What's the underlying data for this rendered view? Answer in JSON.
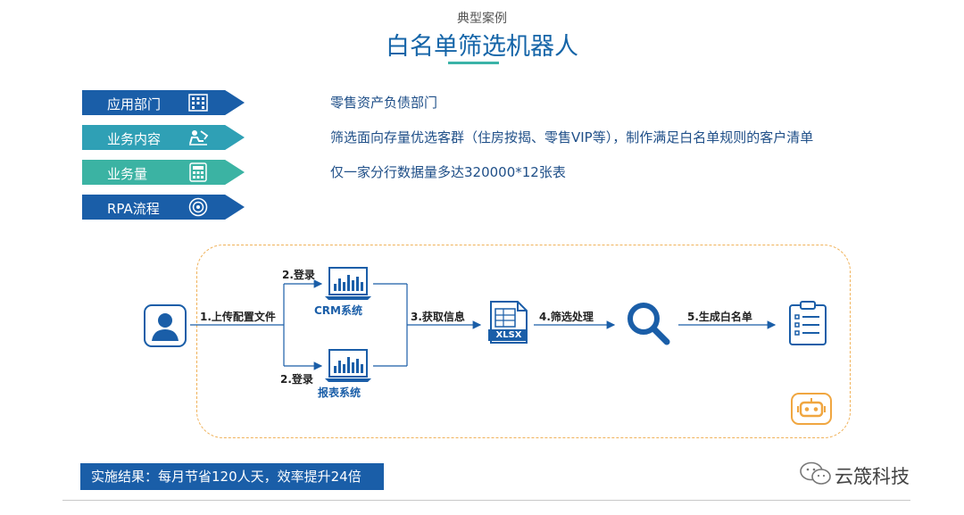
{
  "header": {
    "subtitle": "典型案例",
    "title": "白名单筛选机器人"
  },
  "tags": [
    {
      "label": "应用部门",
      "icon": "building-icon"
    },
    {
      "label": "业务内容",
      "icon": "worker-desk-icon"
    },
    {
      "label": "业务量",
      "icon": "calculator-icon"
    },
    {
      "label": "RPA流程",
      "icon": "target-icon"
    }
  ],
  "info": [
    "零售资产负债部门",
    "筛选面向存量优选客群（住房按揭、零售VIP等），制作满足白名单规则的客户清单",
    "仅一家分行数据量多达320000*12张表"
  ],
  "flow": {
    "step1": "1.上传配置文件",
    "step2_top": "2.登录",
    "step2_bottom": "2.登录",
    "crm": "CRM系统",
    "report": "报表系统",
    "step3": "3.获取信息",
    "xlsx": "XLSX",
    "step4": "4.筛选处理",
    "step5": "5.生成白名单"
  },
  "result": "实施结果：每月节省120人天，效率提升24倍",
  "brand": "云筬科技",
  "colors": {
    "primary_blue": "#1a5ea8",
    "teal": "#3bb3a3",
    "cyan": "#2fa0b5",
    "dashed_orange": "#f0b25a"
  }
}
